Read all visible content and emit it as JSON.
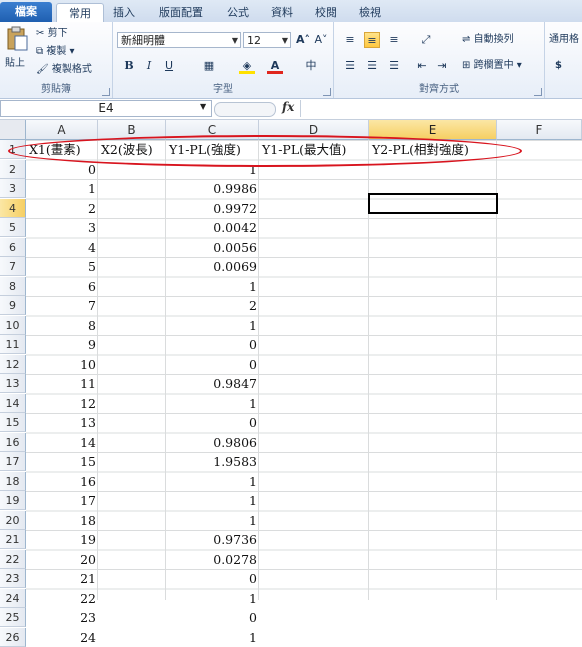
{
  "tabs": [
    "檔案",
    "常用",
    "插入",
    "版面配置",
    "公式",
    "資料",
    "校閱",
    "檢視"
  ],
  "active_tab": "常用",
  "clipboard": {
    "paste": "貼上",
    "cut": "剪下",
    "copy": "複製",
    "format_painter": "複製格式",
    "label": "剪貼簿"
  },
  "font": {
    "name": "新細明體",
    "size": "12",
    "label": "字型",
    "bold": "B",
    "italic": "I",
    "underline": "U",
    "grow": "A˄",
    "shrink": "A˅",
    "phonetic": "中"
  },
  "alignment": {
    "wrap": "自動換列",
    "merge": "跨欄置中",
    "label": "對齊方式"
  },
  "number": {
    "format": "通用格",
    "currency": "$"
  },
  "formula_bar": {
    "name_box": "E4",
    "fx": "fx",
    "value": ""
  },
  "columns": [
    "A",
    "B",
    "C",
    "D",
    "E",
    "F"
  ],
  "selected_column": "E",
  "rows": [
    "1",
    "2",
    "3",
    "4",
    "5",
    "6",
    "7",
    "8",
    "9",
    "10",
    "11",
    "12",
    "13",
    "14",
    "15",
    "16",
    "17",
    "18",
    "19",
    "20",
    "21",
    "22",
    "23",
    "24",
    "25",
    "26"
  ],
  "selected_row": "4",
  "headers": [
    "X1(畫素)",
    "X2(波長)",
    "Y1-PL(強度)",
    "Y1-PL(最大值)",
    "Y2-PL(相對強度)"
  ],
  "col_a": [
    "0",
    "1",
    "2",
    "3",
    "4",
    "5",
    "6",
    "7",
    "8",
    "9",
    "10",
    "11",
    "12",
    "13",
    "14",
    "15",
    "16",
    "17",
    "18",
    "19",
    "20",
    "21",
    "22",
    "23",
    "24"
  ],
  "col_c": [
    "1",
    "0.9986",
    "0.9972",
    "0.0042",
    "0.0056",
    "0.0069",
    "1",
    "2",
    "1",
    "0",
    "0",
    "0.9847",
    "1",
    "0",
    "0.9806",
    "1.9583",
    "1",
    "1",
    "1",
    "0.9736",
    "0.0278",
    "0",
    "1",
    "0",
    "1"
  ],
  "colors": {
    "annotation": "#d8141e",
    "selection": "#f6cf63",
    "file_tab": "#1f5fb0"
  }
}
